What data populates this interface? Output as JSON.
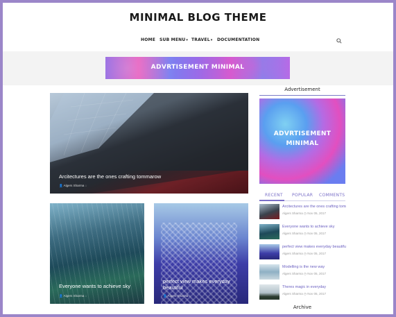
{
  "site": {
    "title": "MINIMAL BLOG THEME"
  },
  "nav": {
    "items": [
      {
        "label": "HOME"
      },
      {
        "label": "SUB MENU"
      },
      {
        "label": "TRAVEL"
      },
      {
        "label": "DOCUMENTATION"
      }
    ],
    "search_icon": "search-icon"
  },
  "top_ad": {
    "text": "ADVRTISEMENT MINIMAL"
  },
  "posts": {
    "featured": {
      "title": "Arcitectures are the ones crafting tommarow",
      "author": "Algers Sharma"
    },
    "card2": {
      "title": "Everyone wants to achieve sky",
      "author": "Algers Sharma"
    },
    "card3": {
      "title": "perfect view makes everyday beautiful",
      "author": "Algers Sharma"
    }
  },
  "sidebar": {
    "ad_heading": "Advertisement",
    "ad_text_line1": "ADVRTISEMENT",
    "ad_text_line2": "MINIMAL",
    "tabs": [
      {
        "label": "RECENT"
      },
      {
        "label": "POPULAR"
      },
      {
        "label": "COMMENTS"
      }
    ],
    "recent": [
      {
        "title": "Arcitectures are the ones crafting tommarow",
        "meta": "Algers Sharma  ◷ Nov 05, 2017"
      },
      {
        "title": "Everyone wants to achieve sky",
        "meta": "Algers Sharma  ◷ Nov 05, 2017"
      },
      {
        "title": "perfect view makes everyday beautiful",
        "meta": "Algers Sharma  ◷ Nov 05, 2017"
      },
      {
        "title": "Modelling is the new way",
        "meta": "Algers Sharma  ◷ Nov 05, 2017"
      },
      {
        "title": "Theres magic in everyday",
        "meta": "Algers Sharma  ◷ Nov 05, 2017"
      }
    ],
    "archive_heading": "Archive"
  },
  "colors": {
    "frame": "#9b86c9",
    "accent": "#7a6fc7"
  }
}
